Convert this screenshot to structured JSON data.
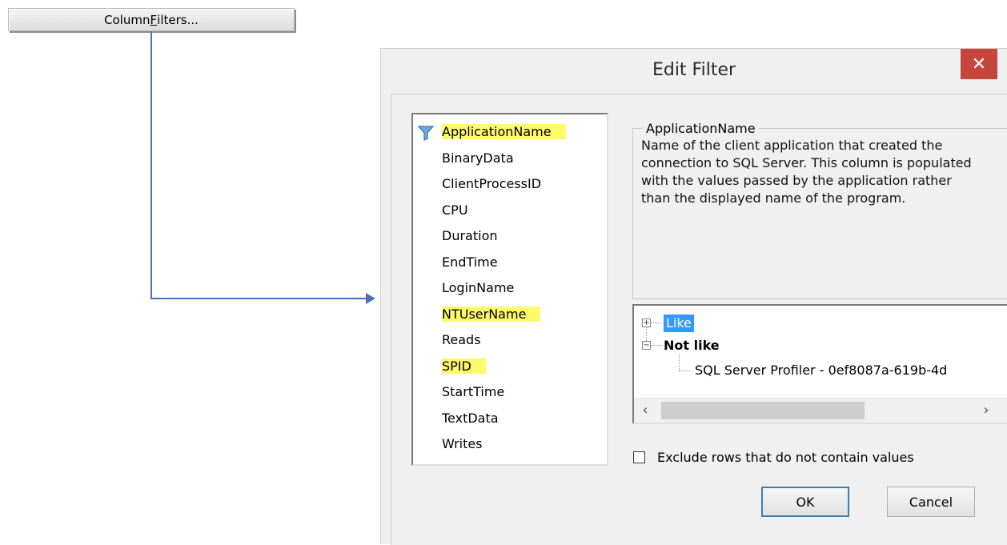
{
  "column_filters_button": {
    "label_before": "Column ",
    "label_underlined": "F",
    "label_after": "ilters..."
  },
  "dialog": {
    "title": "Edit Filter",
    "close_glyph": "✕",
    "columns": [
      {
        "label": "ApplicationName",
        "highlighted": true,
        "filtered": true
      },
      {
        "label": "BinaryData",
        "highlighted": false
      },
      {
        "label": "ClientProcessID",
        "highlighted": false
      },
      {
        "label": "CPU",
        "highlighted": false
      },
      {
        "label": "Duration",
        "highlighted": false
      },
      {
        "label": "EndTime",
        "highlighted": false
      },
      {
        "label": "LoginName",
        "highlighted": false
      },
      {
        "label": "NTUserName",
        "highlighted": true
      },
      {
        "label": "Reads",
        "highlighted": false
      },
      {
        "label": "SPID",
        "highlighted": true
      },
      {
        "label": "StartTime",
        "highlighted": false
      },
      {
        "label": "TextData",
        "highlighted": false
      },
      {
        "label": "Writes",
        "highlighted": false
      }
    ],
    "description_group": {
      "title": "ApplicationName",
      "text": "Name of the client application that created the connection to SQL Server. This column is populated with the values passed by the application rather than the displayed name of the program."
    },
    "criteria_tree": {
      "like": {
        "label": "Like",
        "expander": "+"
      },
      "not_like": {
        "label": "Not like",
        "expander": "−"
      },
      "not_like_value": "SQL Server Profiler - 0ef8087a-619b-4d",
      "scroll_left": "‹",
      "scroll_right": "›"
    },
    "exclude_checkbox": {
      "label": "Exclude rows that do not contain values",
      "checked": false
    },
    "ok_label": "OK",
    "cancel_label": "Cancel"
  },
  "colors": {
    "connector": "#4a72b2",
    "highlight": "#fffa6b",
    "selection": "#3399ff",
    "close": "#c7463c"
  },
  "icons": {
    "filter": "funnel-icon"
  }
}
